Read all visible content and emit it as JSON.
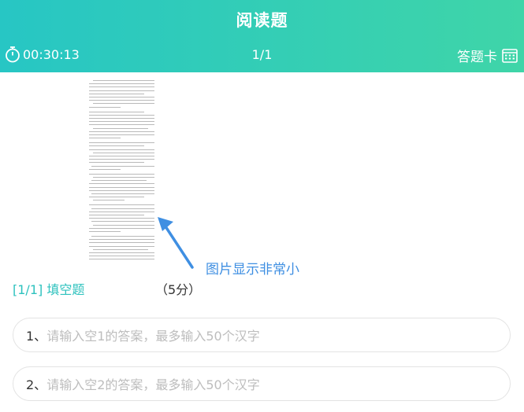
{
  "header": {
    "title": "阅读题",
    "timer": "00:30:13",
    "pager": "1/1",
    "answer_card_label": "答题卡"
  },
  "annotation": {
    "text": "图片显示非常小"
  },
  "question": {
    "index": "[1/1]",
    "type": "填空题",
    "score": "（5分）"
  },
  "blanks": [
    {
      "index": "1、",
      "placeholder": "请输入空1的答案，最多输入50个汉字"
    },
    {
      "index": "2、",
      "placeholder": "请输入空2的答案，最多输入50个汉字"
    }
  ],
  "colors": {
    "header_start": "#27c6c4",
    "header_end": "#3fd5a8",
    "accent": "#2ec2be",
    "annotation": "#3f8fe2"
  }
}
